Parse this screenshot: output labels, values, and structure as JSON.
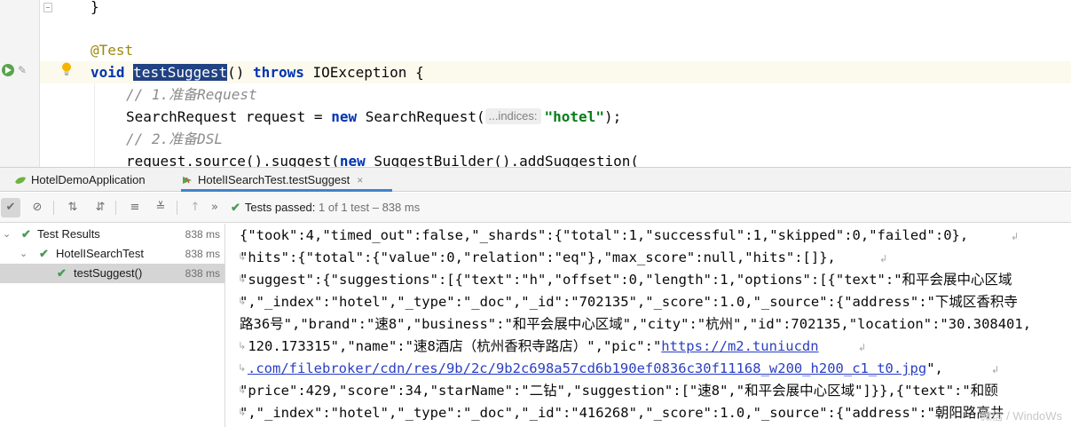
{
  "editor": {
    "lines": {
      "brace": "}",
      "annotation": "@Test",
      "kw_void": "void",
      "method_name": "testSuggest",
      "sig_rest_1": "() ",
      "kw_throws": "throws",
      "sig_rest_2": " IOException {",
      "comment1": "// 1.准备Request",
      "req_decl": "SearchRequest request = ",
      "kw_new": "new",
      "req_ctor": " SearchRequest(",
      "hint_indices": "...indices:",
      "hotel_str": "\"hotel\"",
      "req_end": ");",
      "comment2": "// 2.准备DSL",
      "src_1": "request.source().suggest(",
      "src_kw_new": "new",
      "src_2": " SuggestBuilder().addSuggestion("
    }
  },
  "run_tabs": [
    {
      "label": "HotelDemoApplication",
      "icon": "spring-boot-icon"
    },
    {
      "label": "HotelISearchTest.testSuggest",
      "icon": "test-run-icon",
      "close": "×"
    }
  ],
  "toolbar": {
    "tests_passed_label": "Tests passed:",
    "tests_passed_detail": "1 of 1 test – 838 ms",
    "more": "»"
  },
  "tree": [
    {
      "label": "Test Results",
      "time": "838 ms"
    },
    {
      "label": "HotelISearchTest",
      "time": "838 ms"
    },
    {
      "label": "testSuggest()",
      "time": "838 ms"
    }
  ],
  "console": {
    "lines": [
      "{\"took\":4,\"timed_out\":false,\"_shards\":{\"total\":1,\"successful\":1,\"skipped\":0,\"failed\":0},",
      "\"hits\":{\"total\":{\"value\":0,\"relation\":\"eq\"},\"max_score\":null,\"hits\":[]},",
      "\"suggest\":{\"suggestions\":[{\"text\":\"h\",\"offset\":0,\"length\":1,\"options\":[{\"text\":\"和平会展中心区域",
      "\",\"_index\":\"hotel\",\"_type\":\"_doc\",\"_id\":\"702135\",\"_score\":1.0,\"_source\":{\"address\":\"下城区香积寺",
      "路36号\",\"brand\":\"速8\",\"business\":\"和平会展中心区域\",\"city\":\"杭州\",\"id\":702135,\"location\":\"30.308401,",
      " 120.173315\",\"name\":\"速8酒店（杭州香积寺路店）\",\"pic\":\"",
      "\"price\":429,\"score\":34,\"starName\":\"二钻\",\"suggestion\":[\"速8\",\"和平会展中心区域\"]}},{\"text\":\"和颐",
      "\",\"_index\":\"hotel\",\"_type\":\"_doc\",\"_id\":\"416268\",\"_score\":1.0,\"_source\":{\"address\":\"朝阳路高井"
    ],
    "link_part1": "https://m2.tuniucdn",
    "link_part2": ".com/filebroker/cdn/res/9b/2c/9b2c698a57cd6b190ef0836c30f11168_w200_h200_c1_t0.jpg",
    "link_tail": "\",",
    "watermark": "微信 / WindoWs"
  },
  "colors": {
    "keyword": "#0033b3",
    "annotation": "#9e880d",
    "comment": "#8c8c8c",
    "string": "#067d17",
    "selection": "#214283",
    "pass_green": "#499c54",
    "tab_underline": "#4083c9",
    "link": "#2a3fc2"
  }
}
